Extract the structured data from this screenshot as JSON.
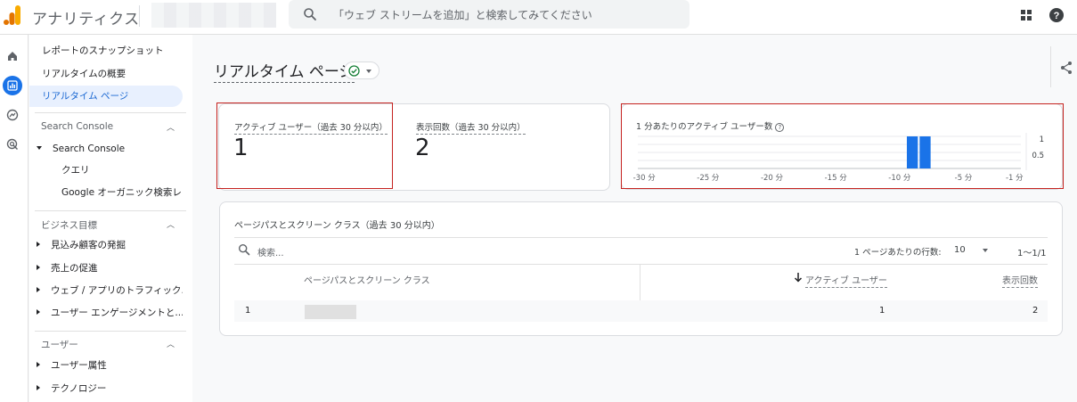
{
  "header": {
    "app_title": "アナリティクス",
    "search_placeholder": "「ウェブ ストリームを追加」と検索してみてください",
    "icons": [
      "analytics-logo",
      "search-icon",
      "apps-grid-icon",
      "help-icon"
    ],
    "brand_colors": {
      "logo_orange": "#f9ab00",
      "logo_dark_orange": "#e37400",
      "accent_blue": "#1a73e8"
    }
  },
  "rail": {
    "icons": [
      "home-icon",
      "reports-icon",
      "explore-icon",
      "advertising-icon"
    ],
    "active": "reports-icon"
  },
  "nav": {
    "items_top": [
      "レポートのスナップショット",
      "リアルタイムの概要",
      "リアルタイム ページ"
    ],
    "active_index": 2,
    "section_search_console": "Search Console",
    "search_console_group": "Search Console",
    "search_console_children": [
      "クエリ",
      "Google オーガニック検索レ..."
    ],
    "section_business": "ビジネス目標",
    "business_items": [
      "見込み顧客の発掘",
      "売上の促進",
      "ウェブ / アプリのトラフィック...",
      "ユーザー エンゲージメントと..."
    ],
    "section_user": "ユーザー",
    "user_items": [
      "ユーザー属性",
      "テクノロジー"
    ]
  },
  "page": {
    "title": "リアルタイム ページ",
    "status": "check"
  },
  "metrics": {
    "active_users_label": "アクティブ ユーザー（過去 30 分以内）",
    "active_users_value": "1",
    "views_label": "表示回数（過去 30 分以内）",
    "views_value": "2"
  },
  "chart_data": {
    "type": "bar",
    "title": "1 分あたりのアクティブ ユーザー数",
    "x": [
      -30,
      -29,
      -28,
      -27,
      -26,
      -25,
      -24,
      -23,
      -22,
      -21,
      -20,
      -19,
      -18,
      -17,
      -16,
      -15,
      -14,
      -13,
      -12,
      -11,
      -10,
      -9,
      -8,
      -7,
      -6,
      -5,
      -4,
      -3,
      -2,
      -1
    ],
    "values": [
      0,
      0,
      0,
      0,
      0,
      0,
      0,
      0,
      0,
      0,
      0,
      0,
      0,
      0,
      0,
      0,
      0,
      0,
      0,
      0,
      0,
      1,
      1,
      0,
      0,
      0,
      0,
      0,
      0,
      0
    ],
    "x_tick_labels": [
      "-30 分",
      "-25 分",
      "-20 分",
      "-15 分",
      "-10 分",
      "-5 分",
      "-1 分"
    ],
    "x_tick_values": [
      -30,
      -25,
      -20,
      -15,
      -10,
      -5,
      -1
    ],
    "y_tick_labels": [
      "1",
      "0.5"
    ],
    "y_tick_values": [
      1,
      0.5
    ],
    "ylim": [
      0,
      1
    ],
    "grid": true,
    "bar_color": "#1a73e8"
  },
  "table": {
    "title": "ページパスとスクリーン クラス（過去 30 分以内）",
    "search_placeholder": "検索...",
    "rows_per_page_label": "1 ページあたりの行数:",
    "rows_per_page_value": "10",
    "pagination": "1〜1/1",
    "columns": [
      "ページパスとスクリーン クラス",
      "アクティブ ユーザー",
      "表示回数"
    ],
    "rows": [
      {
        "index": "1",
        "path": "",
        "active_users": "1",
        "views": "2"
      }
    ]
  }
}
